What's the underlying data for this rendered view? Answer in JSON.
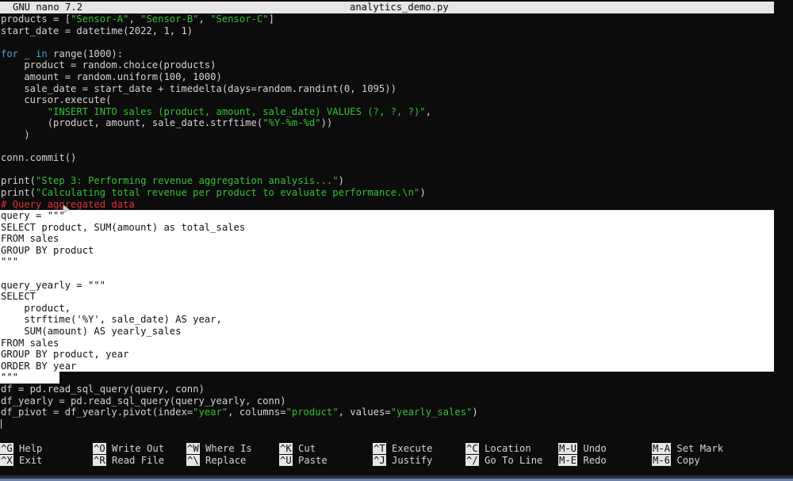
{
  "titlebar": {
    "app": "GNU nano 7.2",
    "filename": "analytics_demo.py"
  },
  "code_lines": [
    [
      {
        "t": "products = [",
        "c": ""
      },
      {
        "t": "\"Sensor-A\"",
        "c": "str"
      },
      {
        "t": ", ",
        "c": ""
      },
      {
        "t": "\"Sensor-B\"",
        "c": "str"
      },
      {
        "t": ", ",
        "c": ""
      },
      {
        "t": "\"Sensor-C\"",
        "c": "str"
      },
      {
        "t": "]",
        "c": ""
      }
    ],
    [
      {
        "t": "start_date = datetime(2022, 1, 1)",
        "c": ""
      }
    ],
    [],
    [
      {
        "t": "for",
        "c": "kw"
      },
      {
        "t": " _ ",
        "c": ""
      },
      {
        "t": "in",
        "c": "kw"
      },
      {
        "t": " range(1000):",
        "c": ""
      }
    ],
    [
      {
        "t": "    product = random.choice(products)",
        "c": ""
      }
    ],
    [
      {
        "t": "    amount = random.uniform(100, 1000)",
        "c": ""
      }
    ],
    [
      {
        "t": "    sale_date = start_date + timedelta(days=random.randint(0, 1095))",
        "c": ""
      }
    ],
    [
      {
        "t": "    cursor.execute(",
        "c": ""
      }
    ],
    [
      {
        "t": "        ",
        "c": ""
      },
      {
        "t": "\"INSERT INTO sales (product, amount, sale_date) VALUES (?, ?, ?)\"",
        "c": "str"
      },
      {
        "t": ",",
        "c": ""
      }
    ],
    [
      {
        "t": "        (product, amount, sale_date.strftime(",
        "c": ""
      },
      {
        "t": "\"%Y-%m-%d\"",
        "c": "str"
      },
      {
        "t": "))",
        "c": ""
      }
    ],
    [
      {
        "t": "    )",
        "c": ""
      }
    ],
    [],
    [
      {
        "t": "conn.commit()",
        "c": ""
      }
    ],
    [],
    [
      {
        "t": "print(",
        "c": ""
      },
      {
        "t": "\"Step 3: Performing revenue aggregation analysis...\"",
        "c": "str"
      },
      {
        "t": ")",
        "c": ""
      }
    ],
    [
      {
        "t": "print(",
        "c": ""
      },
      {
        "t": "\"Calculating total revenue per product to evaluate performance.\\n\"",
        "c": "str"
      },
      {
        "t": ")",
        "c": ""
      }
    ],
    [
      {
        "t": "# Query aggregated data",
        "c": "comment"
      }
    ],
    [
      {
        "t": "query = \"\"\"",
        "c": "",
        "sel": "full"
      }
    ],
    [
      {
        "t": "SELECT product, SUM(amount) as total_sales",
        "c": "",
        "sel": "full"
      }
    ],
    [
      {
        "t": "FROM sales",
        "c": "",
        "sel": "full"
      }
    ],
    [
      {
        "t": "GROUP BY product",
        "c": "",
        "sel": "full"
      }
    ],
    [
      {
        "t": "\"\"\"",
        "c": "",
        "sel": "full"
      }
    ],
    [
      {
        "t": "",
        "c": "",
        "sel": "full"
      }
    ],
    [
      {
        "t": "query_yearly = \"\"\"",
        "c": "",
        "sel": "full"
      }
    ],
    [
      {
        "t": "SELECT",
        "c": "",
        "sel": "full"
      }
    ],
    [
      {
        "t": "    product,",
        "c": "",
        "sel": "full"
      }
    ],
    [
      {
        "t": "    strftime('%Y', sale_date) AS year,",
        "c": "",
        "sel": "full"
      }
    ],
    [
      {
        "t": "    SUM(amount) AS yearly_sales",
        "c": "",
        "sel": "full"
      }
    ],
    [
      {
        "t": "FROM sales",
        "c": "",
        "sel": "full"
      }
    ],
    [
      {
        "t": "GROUP BY product, year",
        "c": "",
        "sel": "full"
      }
    ],
    [
      {
        "t": "ORDER BY year",
        "c": "",
        "sel": "full"
      }
    ],
    [
      {
        "t": "\"\"\"",
        "c": "",
        "sel": "partial"
      }
    ],
    [
      {
        "t": "df = pd.read_sql_query(query, conn)",
        "c": ""
      }
    ],
    [
      {
        "t": "df_yearly = pd.read_sql_query(query_yearly, conn)",
        "c": ""
      }
    ],
    [
      {
        "t": "df_pivot = df_yearly.pivot(index=",
        "c": ""
      },
      {
        "t": "\"year\"",
        "c": "str"
      },
      {
        "t": ", columns=",
        "c": ""
      },
      {
        "t": "\"product\"",
        "c": "str"
      },
      {
        "t": ", values=",
        "c": ""
      },
      {
        "t": "\"yearly_sales\"",
        "c": "str"
      },
      {
        "t": ")",
        "c": ""
      }
    ],
    [
      {
        "t": "",
        "c": "",
        "cursor": true
      }
    ]
  ],
  "shortcuts": {
    "row1": [
      {
        "key": "^G",
        "label": "Help",
        "name": "help"
      },
      {
        "key": "^O",
        "label": "Write Out",
        "name": "write-out"
      },
      {
        "key": "^W",
        "label": "Where Is",
        "name": "where-is"
      },
      {
        "key": "^K",
        "label": "Cut",
        "name": "cut"
      },
      {
        "key": "^T",
        "label": "Execute",
        "name": "execute"
      },
      {
        "key": "^C",
        "label": "Location",
        "name": "location"
      },
      {
        "key": "M-U",
        "label": "Undo",
        "name": "undo"
      },
      {
        "key": "M-A",
        "label": "Set Mark",
        "name": "set-mark"
      }
    ],
    "row2": [
      {
        "key": "^X",
        "label": "Exit",
        "name": "exit"
      },
      {
        "key": "^R",
        "label": "Read File",
        "name": "read-file"
      },
      {
        "key": "^\\",
        "label": "Replace",
        "name": "replace"
      },
      {
        "key": "^U",
        "label": "Paste",
        "name": "paste"
      },
      {
        "key": "^J",
        "label": "Justify",
        "name": "justify"
      },
      {
        "key": "^/",
        "label": "Go To Line",
        "name": "go-to-line"
      },
      {
        "key": "M-E",
        "label": "Redo",
        "name": "redo"
      },
      {
        "key": "M-6",
        "label": "Copy",
        "name": "copy"
      }
    ]
  }
}
